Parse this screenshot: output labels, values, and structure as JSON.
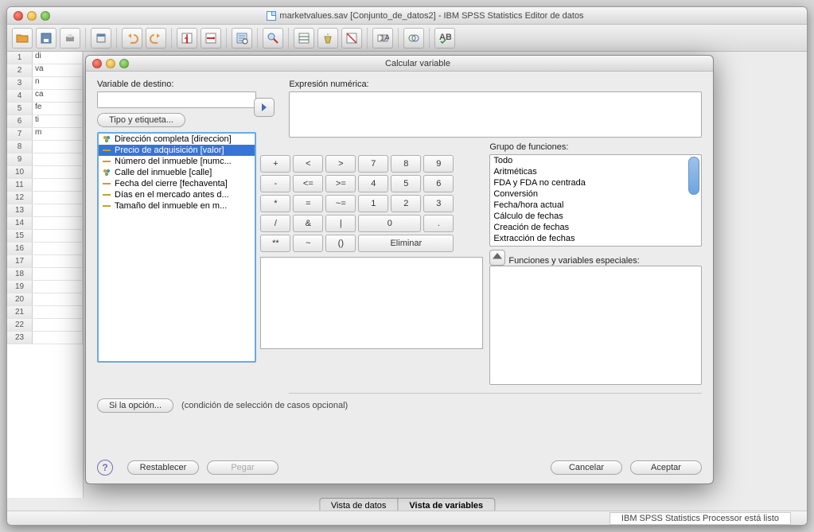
{
  "main_window": {
    "title": "marketvalues.sav [Conjunto_de_datos2] - IBM SPSS Statistics Editor de datos"
  },
  "grid": {
    "rows": [
      {
        "n": "1",
        "v": "di"
      },
      {
        "n": "2",
        "v": "va"
      },
      {
        "n": "3",
        "v": "n"
      },
      {
        "n": "4",
        "v": "ca"
      },
      {
        "n": "5",
        "v": "fe"
      },
      {
        "n": "6",
        "v": "ti"
      },
      {
        "n": "7",
        "v": "m"
      },
      {
        "n": "8",
        "v": ""
      },
      {
        "n": "9",
        "v": ""
      },
      {
        "n": "10",
        "v": ""
      },
      {
        "n": "11",
        "v": ""
      },
      {
        "n": "12",
        "v": ""
      },
      {
        "n": "13",
        "v": ""
      },
      {
        "n": "14",
        "v": ""
      },
      {
        "n": "15",
        "v": ""
      },
      {
        "n": "16",
        "v": ""
      },
      {
        "n": "17",
        "v": ""
      },
      {
        "n": "18",
        "v": ""
      },
      {
        "n": "19",
        "v": ""
      },
      {
        "n": "20",
        "v": ""
      },
      {
        "n": "21",
        "v": ""
      },
      {
        "n": "22",
        "v": ""
      },
      {
        "n": "23",
        "v": ""
      }
    ]
  },
  "view_tabs": {
    "data": "Vista de datos",
    "vars": "Vista de variables"
  },
  "status": "IBM SPSS Statistics Processor está listo",
  "dialog": {
    "title": "Calcular variable",
    "target_label": "Variable de destino:",
    "type_label_btn": "Tipo y etiqueta...",
    "expr_label": "Expresión numérica:",
    "equals": "=",
    "vars": [
      {
        "label": "Dirección completa [direccion]",
        "icon": "nominal",
        "selected": false
      },
      {
        "label": "Precio de adquisición [valor]",
        "icon": "scale",
        "selected": true
      },
      {
        "label": "Número del inmueble [numc...",
        "icon": "scale",
        "selected": false
      },
      {
        "label": "Calle del inmueble [calle]",
        "icon": "nominal",
        "selected": false
      },
      {
        "label": "Fecha del cierre [fechaventa]",
        "icon": "scale",
        "selected": false
      },
      {
        "label": "Días en el mercado antes d...",
        "icon": "scale",
        "selected": false
      },
      {
        "label": "Tamaño del inmueble en m...",
        "icon": "scale",
        "selected": false
      }
    ],
    "keypad": {
      "r1": [
        "+",
        "<",
        ">",
        "7",
        "8",
        "9"
      ],
      "r2": [
        "-",
        "<=",
        ">=",
        "4",
        "5",
        "6"
      ],
      "r3": [
        "*",
        "=",
        "~=",
        "1",
        "2",
        "3"
      ],
      "r4": [
        "/",
        "&",
        "|",
        "0",
        "."
      ],
      "r5": [
        "**",
        "~",
        "()",
        "Eliminar"
      ]
    },
    "func_group_label": "Grupo de funciones:",
    "func_groups": [
      "Todo",
      "Aritméticas",
      "FDA y FDA no centrada",
      "Conversión",
      "Fecha/hora actual",
      "Cálculo de fechas",
      "Creación de fechas",
      "Extracción de fechas"
    ],
    "special_label": "Funciones y variables especiales:",
    "condition_btn": "Si la opción...",
    "condition_text": "(condición de selección de casos opcional)",
    "footer": {
      "reset": "Restablecer",
      "paste": "Pegar",
      "cancel": "Cancelar",
      "ok": "Aceptar"
    }
  }
}
